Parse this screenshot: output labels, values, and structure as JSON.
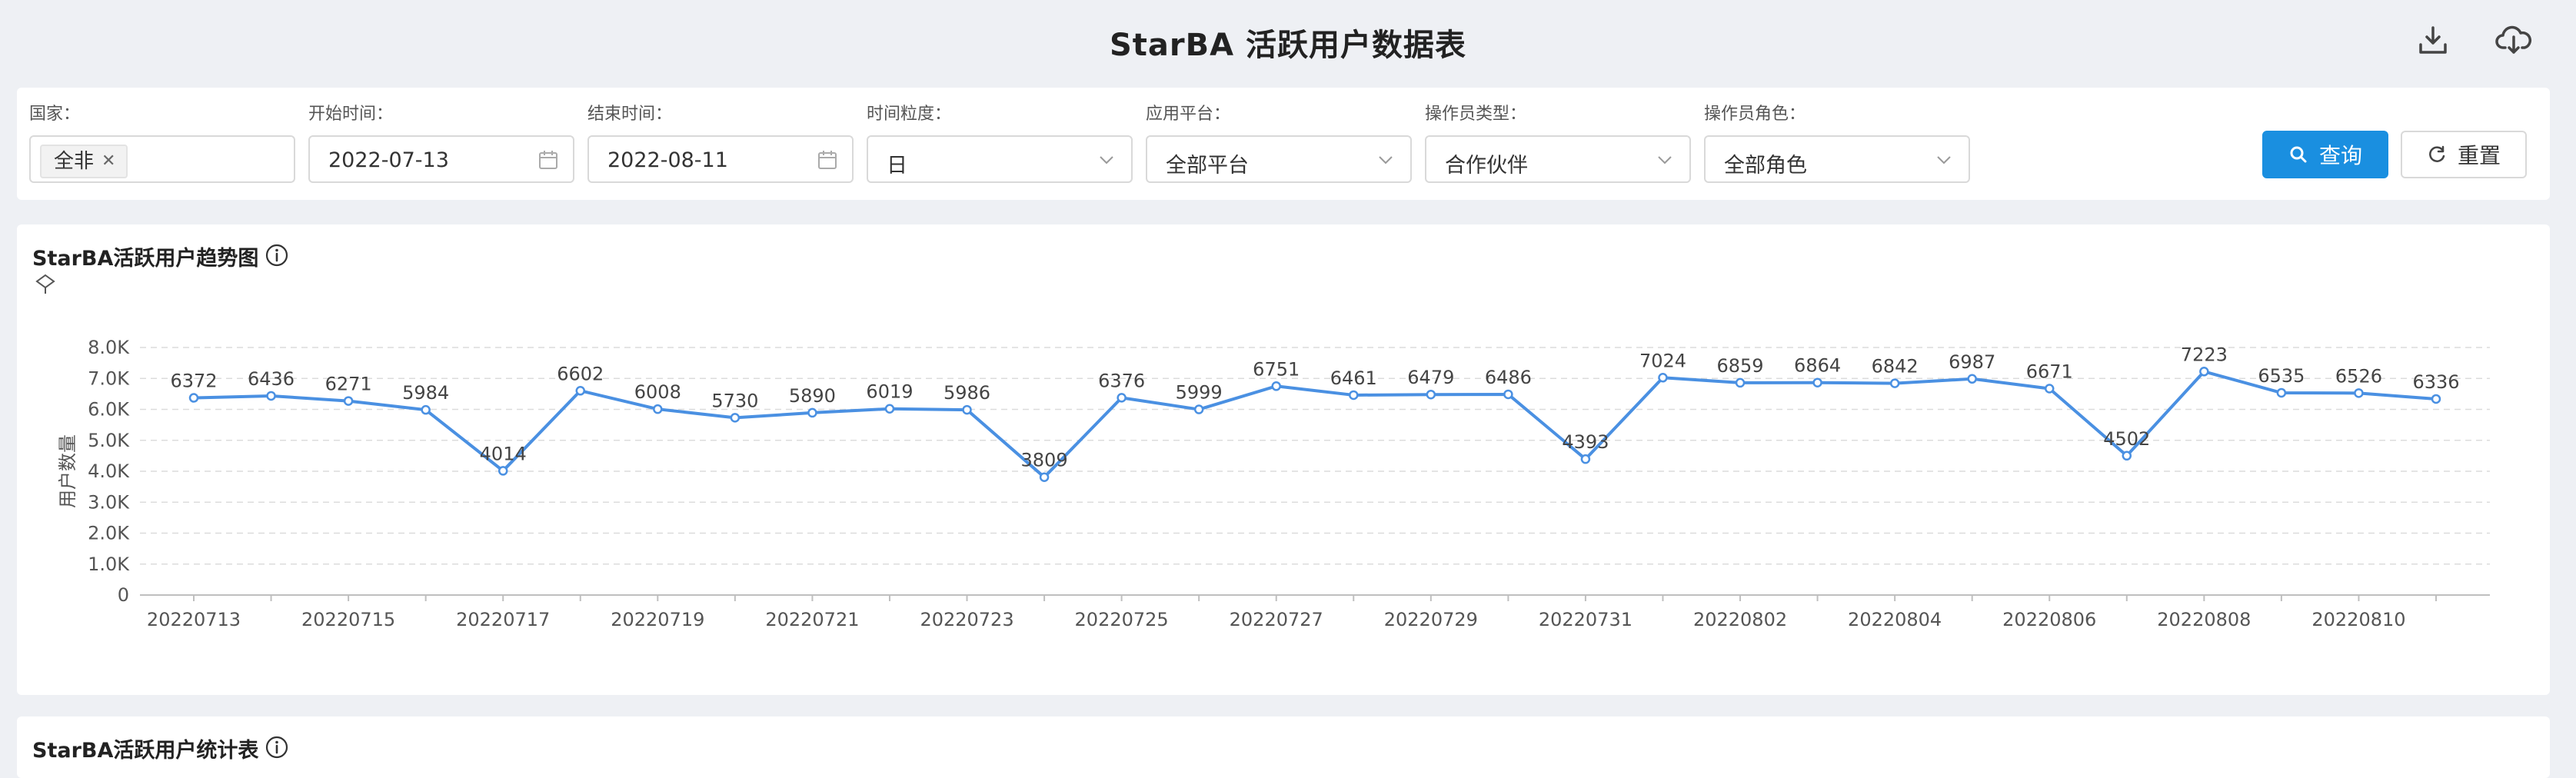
{
  "header": {
    "title": "StarBA 活跃用户数据表",
    "icons": [
      "download-icon",
      "cloud-download-icon"
    ]
  },
  "filters": {
    "country": {
      "label": "国家：",
      "tag": "全非"
    },
    "start_time": {
      "label": "开始时间：",
      "value": "2022-07-13"
    },
    "end_time": {
      "label": "结束时间：",
      "value": "2022-08-11"
    },
    "granularity": {
      "label": "时间粒度：",
      "value": "日"
    },
    "platform": {
      "label": "应用平台：",
      "value": "全部平台"
    },
    "operator_type": {
      "label": "操作员类型：",
      "value": "合作伙伴"
    },
    "operator_role": {
      "label": "操作员角色：",
      "value": "全部角色"
    },
    "query_label": "查询",
    "reset_label": "重置"
  },
  "trend_card": {
    "title": "StarBA活跃用户趋势图"
  },
  "stats_card": {
    "title": "StarBA活跃用户统计表"
  },
  "chart_data": {
    "type": "line",
    "x": [
      "20220713",
      "20220714",
      "20220715",
      "20220716",
      "20220717",
      "20220718",
      "20220719",
      "20220720",
      "20220721",
      "20220722",
      "20220723",
      "20220724",
      "20220725",
      "20220726",
      "20220727",
      "20220728",
      "20220729",
      "20220730",
      "20220731",
      "20220801",
      "20220802",
      "20220803",
      "20220804",
      "20220805",
      "20220806",
      "20220807",
      "20220808",
      "20220809",
      "20220810",
      "20220811"
    ],
    "values": [
      6372,
      6436,
      6271,
      5984,
      4014,
      6602,
      6008,
      5730,
      5890,
      6019,
      5986,
      3809,
      6376,
      5999,
      6751,
      6461,
      6479,
      6486,
      4393,
      7024,
      6859,
      6864,
      6842,
      6987,
      6671,
      4502,
      7223,
      6535,
      6526,
      6336
    ],
    "x_tick_labels": [
      "20220713",
      "20220715",
      "20220717",
      "20220719",
      "20220721",
      "20220723",
      "20220725",
      "20220727",
      "20220729",
      "20220731",
      "20220802",
      "20220804",
      "20220806",
      "20220808",
      "20220810"
    ],
    "y_ticks": [
      "0",
      "1.0K",
      "2.0K",
      "3.0K",
      "4.0K",
      "5.0K",
      "6.0K",
      "7.0K",
      "8.0K"
    ],
    "ylabel": "用户数量",
    "ylim": [
      0,
      8000
    ],
    "grid": true,
    "color": "#4a90e2"
  }
}
